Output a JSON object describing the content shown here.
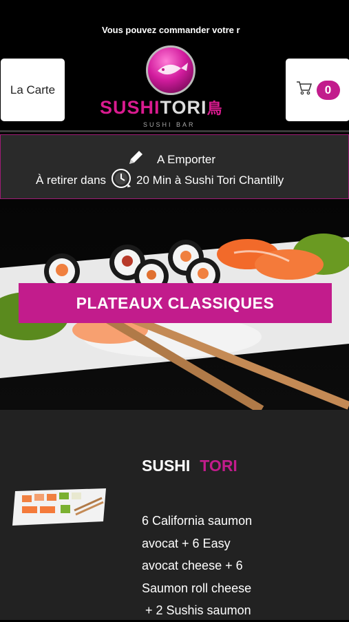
{
  "banner": {
    "text": "Vous pouvez commander votre r"
  },
  "nav": {
    "carte_label": "La Carte",
    "cart_count": "0"
  },
  "logo": {
    "word1": "SUSHI",
    "word2": "TORI",
    "sub": "SUSHI BAR"
  },
  "order": {
    "mode": "A Emporter",
    "pickup_prefix": "À retirer dans",
    "pickup_suffix": "20 Min à Sushi Tori Chantilly"
  },
  "category": {
    "title": "PLATEAUX CLASSIQUES"
  },
  "item": {
    "title_part1": "SUSHI",
    "title_part2": "TORI",
    "desc_lines": [
      "6 California saumon",
      "avocat  + 6 Easy",
      "avocat cheese  + 6",
      "Saumon roll cheese",
      " + 2 Sushis saumon"
    ]
  },
  "colors": {
    "accent": "#c21c8c",
    "background": "#000000",
    "panel": "#222222"
  }
}
